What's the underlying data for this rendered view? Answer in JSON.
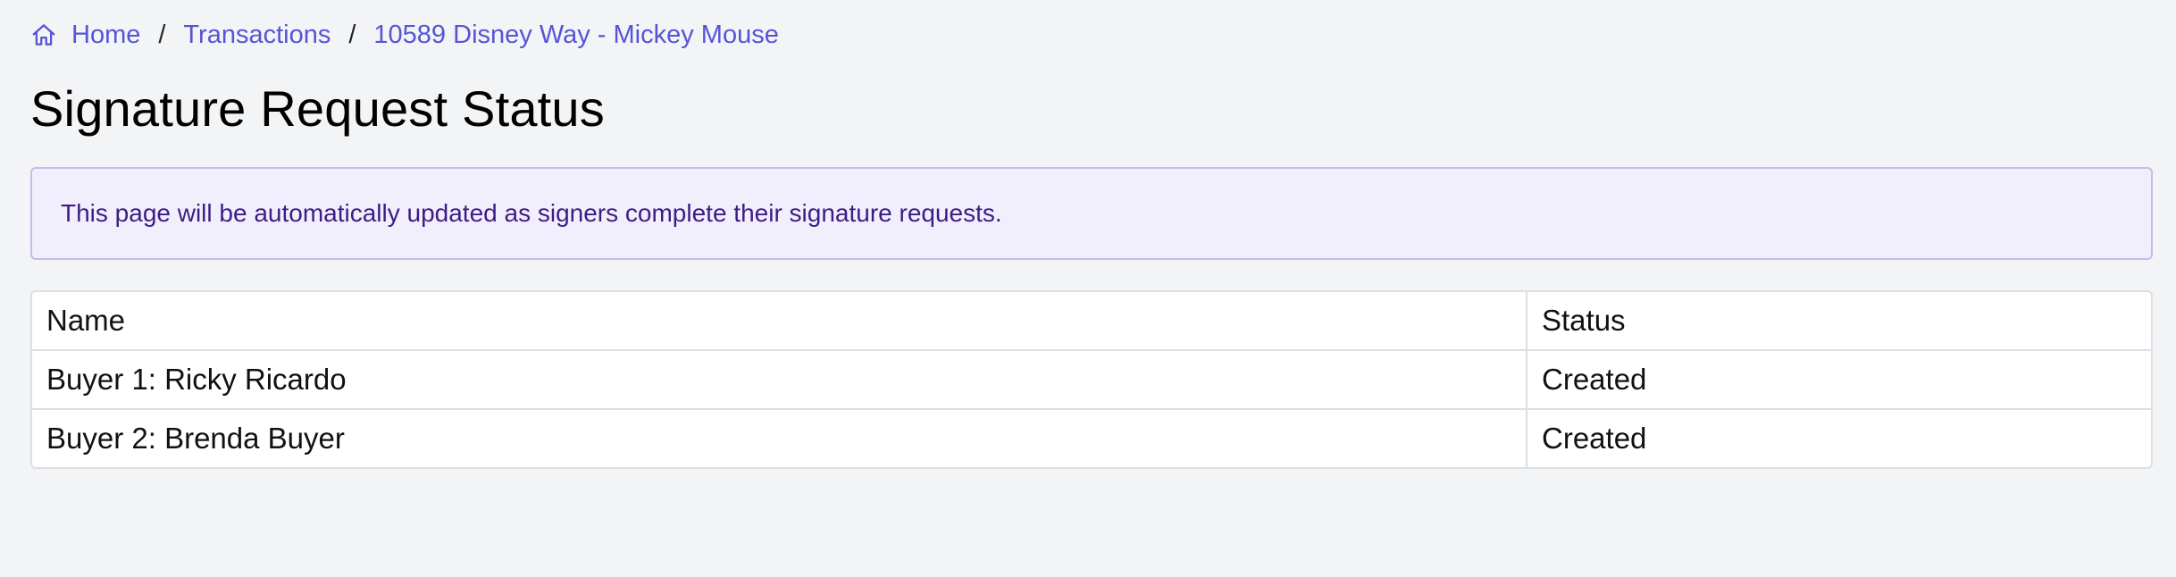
{
  "breadcrumb": {
    "home_icon": "home-icon",
    "home": "Home",
    "separator": "/",
    "transactions": "Transactions",
    "current": "10589 Disney Way - Mickey Mouse"
  },
  "page": {
    "title": "Signature Request Status"
  },
  "alert": {
    "message": "This page will be automatically updated as signers complete their signature requests."
  },
  "table": {
    "headers": {
      "name": "Name",
      "status": "Status"
    },
    "rows": [
      {
        "name": "Buyer 1: Ricky Ricardo",
        "status": "Created"
      },
      {
        "name": "Buyer 2: Brenda Buyer",
        "status": "Created"
      }
    ]
  },
  "colors": {
    "link": "#5754d6",
    "alert_background": "#f2effd",
    "alert_border": "#c9b8ec",
    "alert_text": "#3d1c86",
    "page_background": "#f3f4f6"
  }
}
